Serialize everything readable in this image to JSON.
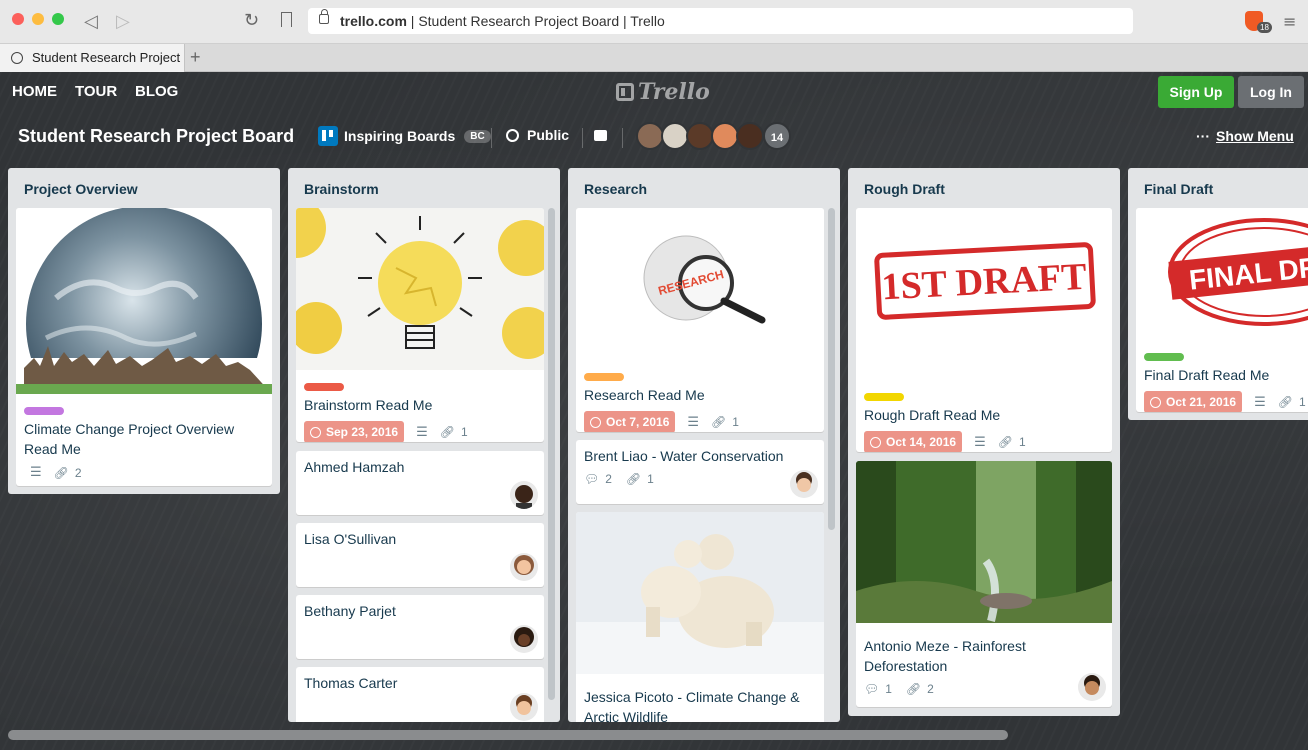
{
  "browser": {
    "url_domain": "trello.com",
    "url_rest": " | Student Research Project Board | Trello",
    "tab_title": "Student Research Project",
    "brave_badge": "18"
  },
  "nav": {
    "home": "HOME",
    "tour": "TOUR",
    "blog": "BLOG",
    "logo": "Trello",
    "signup": "Sign Up",
    "login": "Log In"
  },
  "board": {
    "title": "Student Research Project Board",
    "team": "Inspiring Boards",
    "team_badge": "BC",
    "visibility": "Public",
    "member_count": "14",
    "show_menu": "Show Menu",
    "menu_dots": "···"
  },
  "lists": [
    {
      "title": "Project Overview"
    },
    {
      "title": "Brainstorm"
    },
    {
      "title": "Research"
    },
    {
      "title": "Rough Draft"
    },
    {
      "title": "Final Draft"
    }
  ],
  "cards": {
    "overview": {
      "title": "Climate Change Project Overview Read Me",
      "attachments": "2",
      "label_color": "#c377e0"
    },
    "brainstorm_readme": {
      "title": "Brainstorm Read Me",
      "due": "Sep 23, 2016",
      "attachments": "1",
      "label_color": "#eb5a46"
    },
    "ahmed": {
      "title": "Ahmed Hamzah"
    },
    "lisa": {
      "title": "Lisa O'Sullivan"
    },
    "bethany": {
      "title": "Bethany Parjet"
    },
    "thomas": {
      "title": "Thomas Carter"
    },
    "research_readme": {
      "title": "Research Read Me",
      "due": "Oct 7, 2016",
      "attachments": "1",
      "label_color": "#ffab4a",
      "image_text": "RESEARCH"
    },
    "brent": {
      "title": "Brent Liao - Water Conservation",
      "comments": "2",
      "attachments": "1"
    },
    "jessica": {
      "title": "Jessica Picoto - Climate Change & Arctic Wildlife"
    },
    "rough_readme": {
      "title": "Rough Draft Read Me",
      "due": "Oct 14, 2016",
      "attachments": "1",
      "label_color": "#f2d600",
      "stamp": "1ST DRAFT"
    },
    "antonio": {
      "title": "Antonio Meze - Rainforest Deforestation",
      "comments": "1",
      "attachments": "2"
    },
    "final_readme": {
      "title": "Final Draft Read Me",
      "due": "Oct 21, 2016",
      "attachments": "1",
      "label_color": "#61bd4f",
      "stamp": "FINAL DRA"
    }
  },
  "colors": {
    "accent_green": "#3aaa35",
    "due_red": "#ec9488",
    "list_bg": "#e2e4e6",
    "card_text": "#17394d"
  }
}
